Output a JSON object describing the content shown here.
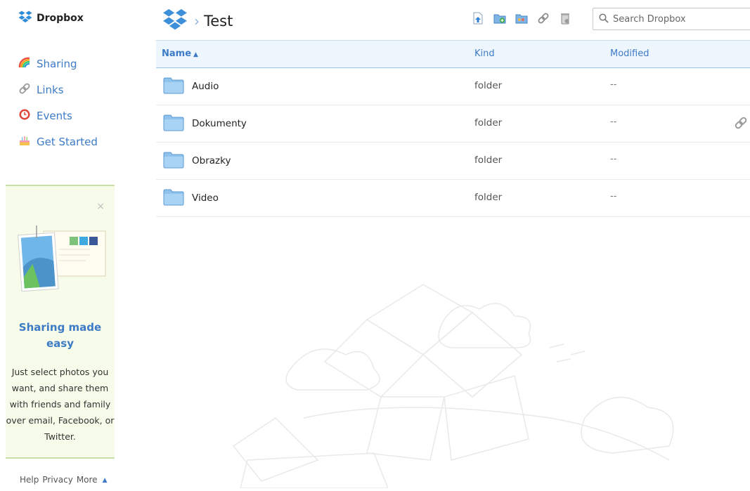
{
  "sidebar": {
    "brand": "Dropbox",
    "nav": [
      {
        "label": "Sharing",
        "icon": "rainbow-icon"
      },
      {
        "label": "Links",
        "icon": "link-icon"
      },
      {
        "label": "Events",
        "icon": "clock-icon"
      },
      {
        "label": "Get Started",
        "icon": "cake-icon"
      }
    ],
    "promo": {
      "close": "×",
      "title": "Sharing made easy",
      "text": "Just select photos you want, and share them with friends and family over email, Facebook, or Twitter."
    },
    "footer": {
      "help": "Help",
      "privacy": "Privacy",
      "more": "More",
      "more_arrow": "▲"
    }
  },
  "header": {
    "breadcrumb_sep": "›",
    "title": "Test",
    "toolbar": [
      "upload-icon",
      "new-folder-icon",
      "share-folder-icon",
      "get-link-icon",
      "trash-icon"
    ],
    "search_placeholder": "Search Dropbox"
  },
  "table": {
    "columns": {
      "name": "Name",
      "sort_arrow": "▲",
      "kind": "Kind",
      "modified": "Modified"
    },
    "rows": [
      {
        "name": "Audio",
        "kind": "folder",
        "modified": "--",
        "shared_link": false
      },
      {
        "name": "Dokumenty",
        "kind": "folder",
        "modified": "--",
        "shared_link": true
      },
      {
        "name": "Obrazky",
        "kind": "folder",
        "modified": "--",
        "shared_link": false
      },
      {
        "name": "Video",
        "kind": "folder",
        "modified": "--",
        "shared_link": false
      }
    ]
  },
  "colors": {
    "accent": "#3d7bc6",
    "header_bg": "#eef6fd",
    "promo_bg": "#f7fcea"
  }
}
